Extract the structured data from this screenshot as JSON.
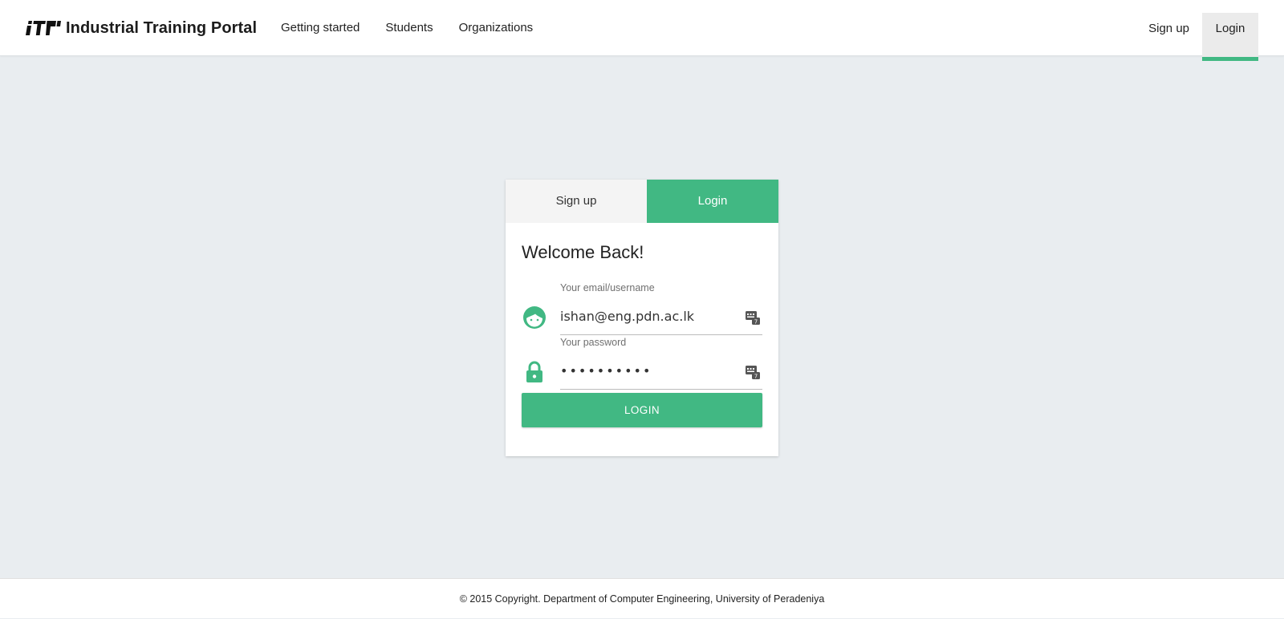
{
  "brand": {
    "name": "Industrial Training Portal",
    "logo_icon": "itp-logo"
  },
  "nav": {
    "links": [
      "Getting started",
      "Students",
      "Organizations"
    ],
    "right": {
      "signup": "Sign up",
      "login": "Login"
    }
  },
  "card": {
    "tabs": {
      "signup": "Sign up",
      "login": "Login"
    },
    "title": "Welcome Back!",
    "email": {
      "label": "Your email/username",
      "value": "ishan@eng.pdn.ac.lk",
      "icon": "user-face-icon"
    },
    "password": {
      "label": "Your password",
      "value": "••••••••••",
      "icon": "lock-icon"
    },
    "button": "LOGIN"
  },
  "footer": {
    "copyright": "© 2015 Copyright.",
    "text": "Department of Computer Engineering, University of Peradeniya"
  },
  "colors": {
    "accent": "#41b883",
    "background": "#e9edf0"
  }
}
